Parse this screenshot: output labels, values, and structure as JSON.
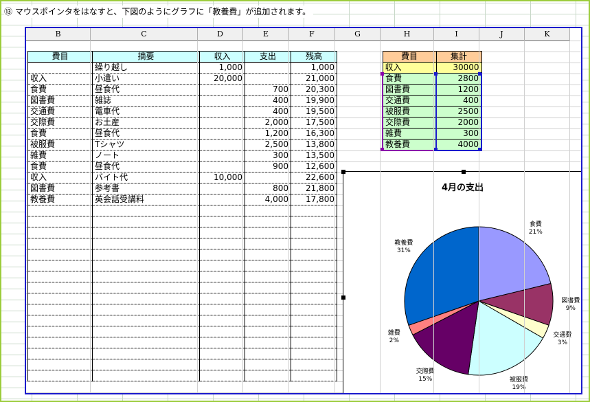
{
  "caption": "⑬ マウスポインタをはなすと、下図のようにグラフに「教養費」が追加されます。",
  "columns": [
    "B",
    "C",
    "D",
    "E",
    "F",
    "G",
    "H",
    "I",
    "J",
    "K"
  ],
  "ledger": {
    "headers": [
      "費目",
      "摘要",
      "収入",
      "支出",
      "残高"
    ],
    "rows": [
      [
        "",
        "繰り越し",
        "1,000",
        "",
        "1,000"
      ],
      [
        "収入",
        "小遣い",
        "20,000",
        "",
        "21,000"
      ],
      [
        "食費",
        "昼食代",
        "",
        "700",
        "20,300"
      ],
      [
        "図書費",
        "雑誌",
        "",
        "400",
        "19,900"
      ],
      [
        "交通費",
        "電車代",
        "",
        "400",
        "19,500"
      ],
      [
        "交際費",
        "お土産",
        "",
        "2,000",
        "17,500"
      ],
      [
        "食費",
        "昼食代",
        "",
        "1,200",
        "16,300"
      ],
      [
        "被服費",
        "Tシャツ",
        "",
        "2,500",
        "13,800"
      ],
      [
        "雑費",
        "ノート",
        "",
        "300",
        "13,500"
      ],
      [
        "食費",
        "昼食代",
        "",
        "900",
        "12,600"
      ],
      [
        "収入",
        "バイト代",
        "10,000",
        "",
        "22,600"
      ],
      [
        "図書費",
        "参考書",
        "",
        "800",
        "21,800"
      ],
      [
        "教養費",
        "英会話受講料",
        "",
        "4,000",
        "17,800"
      ]
    ]
  },
  "summary": {
    "headers": [
      "費目",
      "集計"
    ],
    "rows": [
      [
        "収入",
        "30000"
      ],
      [
        "食費",
        "2800"
      ],
      [
        "図書費",
        "1200"
      ],
      [
        "交通費",
        "400"
      ],
      [
        "被服費",
        "2500"
      ],
      [
        "交際費",
        "2000"
      ],
      [
        "雑費",
        "300"
      ],
      [
        "教養費",
        "4000"
      ]
    ]
  },
  "chart_data": {
    "type": "pie",
    "title": "4月の支出",
    "categories": [
      "食費",
      "図書費",
      "交通費",
      "被服費",
      "交際費",
      "雑費",
      "教養費"
    ],
    "values": [
      2800,
      1200,
      400,
      2500,
      2000,
      300,
      4000
    ],
    "percent_labels": [
      "21%",
      "9%",
      "3%",
      "19%",
      "15%",
      "2%",
      "31%"
    ],
    "colors": [
      "#9999ff",
      "#993366",
      "#ffffcc",
      "#ccffff",
      "#660066",
      "#ff8080",
      "#0066cc"
    ]
  }
}
